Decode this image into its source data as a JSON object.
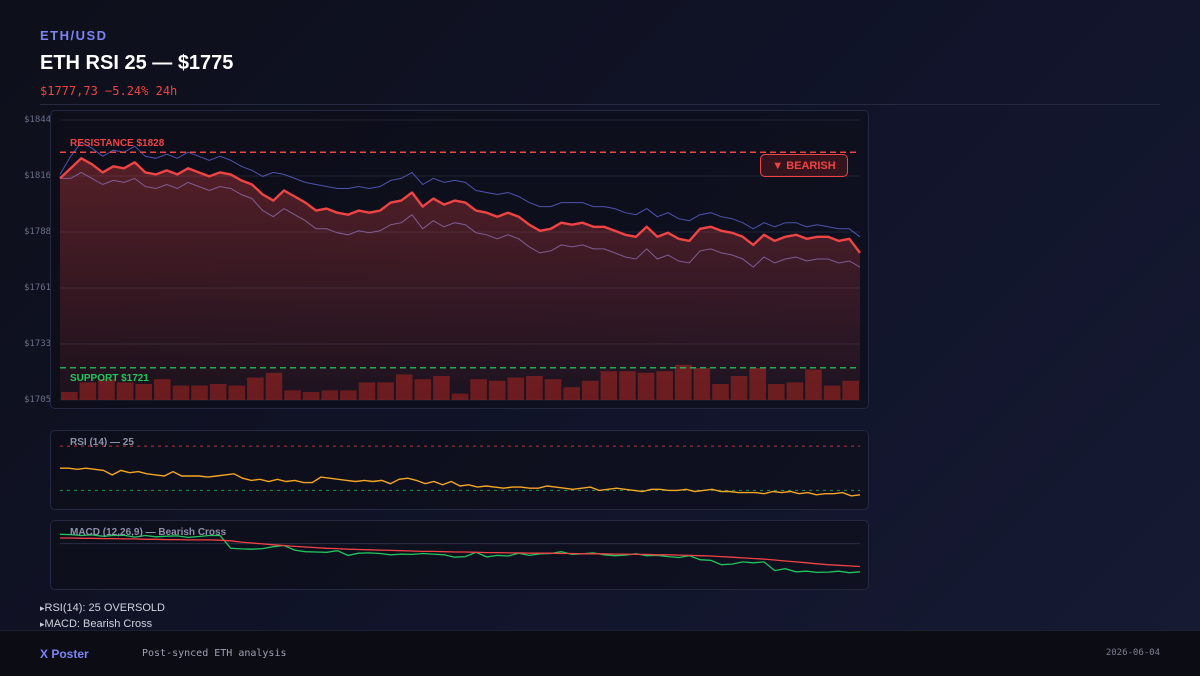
{
  "header": {
    "pair": "ETH/USD",
    "title": "ETH RSI 25 — $1775",
    "price_line": "$1777,73 −5.24% 24h"
  },
  "chart_data": [
    {
      "type": "line",
      "ylim": [
        1705,
        1844
      ],
      "y_ticks": [
        "$1844",
        "$1816",
        "$1788",
        "$1761",
        "$1733",
        "$1705"
      ],
      "x": [
        1,
        2,
        3,
        4,
        5,
        6,
        7,
        8,
        9,
        10,
        11,
        12,
        13,
        14,
        15,
        16,
        17,
        18,
        19,
        20,
        21,
        22,
        23,
        24,
        25,
        26,
        27,
        28,
        29,
        30,
        31,
        32,
        33,
        34,
        35,
        36,
        37,
        38,
        39,
        40,
        41,
        42,
        43,
        44,
        45,
        46,
        47,
        48,
        49,
        50,
        51,
        52,
        53,
        54,
        55,
        56,
        57,
        58,
        59,
        60,
        61,
        62,
        63,
        64,
        65,
        66,
        67,
        68,
        69,
        70,
        71,
        72,
        73,
        74,
        75,
        76,
        77,
        78,
        79,
        80,
        81
      ],
      "series": [
        {
          "role": "price",
          "color": "#ef4444",
          "values": [
            1815,
            1820,
            1825,
            1822,
            1818,
            1821,
            1820,
            1823,
            1818,
            1817,
            1819,
            1817,
            1820,
            1818,
            1816,
            1818,
            1817,
            1814,
            1812,
            1807,
            1804,
            1809,
            1806,
            1803,
            1799,
            1800,
            1798,
            1797,
            1799,
            1798,
            1799,
            1803,
            1804,
            1808,
            1801,
            1805,
            1802,
            1804,
            1803,
            1799,
            1798,
            1796,
            1798,
            1796,
            1792,
            1789,
            1790,
            1793,
            1792,
            1793,
            1791,
            1791,
            1789,
            1787,
            1786,
            1791,
            1786,
            1788,
            1785,
            1784,
            1790,
            1791,
            1789,
            1788,
            1786,
            1782,
            1787,
            1784,
            1786,
            1787,
            1785,
            1786,
            1786,
            1784,
            1785,
            1778
          ]
        },
        {
          "role": "upper-band",
          "color": "#5b5fc7",
          "values": [
            1817,
            1826,
            1833,
            1830,
            1826,
            1829,
            1828,
            1831,
            1826,
            1825,
            1827,
            1825,
            1828,
            1826,
            1824,
            1826,
            1824,
            1821,
            1819,
            1816,
            1818,
            1817,
            1815,
            1813,
            1812,
            1811,
            1810,
            1810,
            1811,
            1810,
            1811,
            1814,
            1815,
            1818,
            1812,
            1815,
            1813,
            1814,
            1813,
            1809,
            1808,
            1807,
            1808,
            1806,
            1803,
            1801,
            1801,
            1803,
            1803,
            1803,
            1801,
            1801,
            1800,
            1798,
            1797,
            1800,
            1796,
            1798,
            1795,
            1794,
            1797,
            1798,
            1796,
            1795,
            1793,
            1790,
            1793,
            1791,
            1793,
            1793,
            1791,
            1792,
            1791,
            1790,
            1790,
            1786
          ]
        },
        {
          "role": "lower-band",
          "color": "#8b6aa8",
          "values": [
            1815,
            1815,
            1818,
            1815,
            1812,
            1814,
            1813,
            1815,
            1811,
            1810,
            1812,
            1810,
            1813,
            1811,
            1809,
            1811,
            1810,
            1807,
            1805,
            1799,
            1796,
            1800,
            1797,
            1794,
            1790,
            1790,
            1788,
            1787,
            1789,
            1788,
            1789,
            1792,
            1793,
            1797,
            1790,
            1794,
            1791,
            1793,
            1792,
            1788,
            1787,
            1785,
            1787,
            1785,
            1781,
            1778,
            1779,
            1782,
            1781,
            1782,
            1780,
            1780,
            1778,
            1776,
            1775,
            1780,
            1775,
            1777,
            1774,
            1773,
            1779,
            1780,
            1778,
            1777,
            1775,
            1771,
            1776,
            1773,
            1775,
            1776,
            1774,
            1775,
            1775,
            1773,
            1774,
            1771
          ]
        }
      ],
      "bars": {
        "color": "#7f1d1d",
        "values": [
          5,
          11,
          13,
          11,
          10,
          13,
          9,
          9,
          10,
          9,
          14,
          17,
          6,
          5,
          6,
          6,
          11,
          11,
          16,
          13,
          15,
          4,
          13,
          12,
          14,
          15,
          13,
          8,
          12,
          18,
          18,
          17,
          18,
          22,
          20,
          10,
          15,
          20,
          10,
          11,
          19,
          9,
          12
        ]
      },
      "resistance": {
        "value": 1828,
        "label": "RESISTANCE $1828",
        "color": "#ef4444"
      },
      "support": {
        "value": 1721,
        "label": "SUPPORT $1721",
        "color": "#22c55e"
      },
      "badge": "▼ BEARISH"
    },
    {
      "type": "line",
      "title": "RSI (14) — 25",
      "ylim": [
        15,
        80
      ],
      "levels": [
        {
          "value": 70,
          "color": "#ef4444"
        },
        {
          "value": 30,
          "color": "#22c55e"
        }
      ],
      "series": [
        {
          "role": "rsi",
          "color": "#f5a524",
          "values": [
            50,
            50,
            49,
            50,
            49,
            48,
            44,
            48,
            46,
            47,
            45,
            44,
            43,
            47,
            43,
            43,
            43,
            42,
            43,
            44,
            45,
            41,
            39,
            40,
            38,
            40,
            38,
            39,
            37,
            37,
            42,
            41,
            40,
            39,
            38,
            39,
            38,
            39,
            36,
            40,
            41,
            39,
            36,
            38,
            35,
            38,
            34,
            35,
            33,
            34,
            33,
            32,
            33,
            33,
            32,
            32,
            34,
            33,
            32,
            31,
            32,
            33,
            30,
            31,
            32,
            31,
            30,
            29,
            31,
            31,
            30,
            30,
            31,
            29,
            30,
            31,
            29,
            29,
            28,
            28,
            28,
            27,
            29,
            28,
            29,
            27,
            28,
            26,
            27,
            27,
            28,
            25,
            26
          ]
        }
      ]
    },
    {
      "type": "line",
      "title": "MACD (12,26,9) — Bearish Cross",
      "ylim": [
        -14,
        6
      ],
      "zero": 0,
      "series": [
        {
          "role": "macd",
          "color": "#22c55e",
          "values": [
            3.0,
            2.9,
            2.6,
            2.8,
            2.4,
            2.6,
            2.7,
            2.1,
            2.6,
            2.2,
            2.4,
            2.5,
            2.0,
            2.3,
            2.6,
            2.6,
            -1.5,
            -1.7,
            -1.8,
            -1.6,
            -1.0,
            -0.6,
            -2.1,
            -2.6,
            -2.7,
            -2.8,
            -2.3,
            -3.8,
            -3.1,
            -3.0,
            -3.2,
            -3.6,
            -3.4,
            -3.5,
            -3.2,
            -3.4,
            -3.6,
            -4.4,
            -4.2,
            -2.8,
            -4.3,
            -3.8,
            -4.0,
            -3.1,
            -3.8,
            -3.3,
            -3.2,
            -2.6,
            -3.5,
            -3.3,
            -3.0,
            -3.6,
            -3.9,
            -3.7,
            -3.3,
            -3.9,
            -3.8,
            -4.2,
            -4.5,
            -3.9,
            -5.2,
            -5.4,
            -6.8,
            -6.6,
            -5.9,
            -6.2,
            -5.9,
            -8.7,
            -8.1,
            -9.1,
            -8.9,
            -9.3,
            -9.2,
            -8.9,
            -9.4,
            -9.1
          ]
        },
        {
          "role": "signal",
          "color": "#ef4444",
          "values": [
            1.8,
            1.8,
            1.7,
            1.7,
            1.6,
            1.6,
            1.5,
            1.5,
            1.4,
            1.4,
            1.3,
            1.3,
            1.2,
            1.2,
            1.2,
            1.1,
            0.9,
            0.5,
            0.2,
            -0.1,
            -0.4,
            -0.6,
            -0.9,
            -1.1,
            -1.3,
            -1.5,
            -1.6,
            -1.8,
            -1.9,
            -2.0,
            -2.1,
            -2.2,
            -2.3,
            -2.4,
            -2.5,
            -2.5,
            -2.6,
            -2.7,
            -2.7,
            -2.8,
            -2.9,
            -2.9,
            -3.0,
            -3.0,
            -3.1,
            -3.1,
            -3.1,
            -3.2,
            -3.2,
            -3.3,
            -3.3,
            -3.3,
            -3.4,
            -3.4,
            -3.5,
            -3.5,
            -3.6,
            -3.6,
            -3.7,
            -3.8,
            -3.9,
            -4.0,
            -4.2,
            -4.4,
            -4.6,
            -4.8,
            -5.0,
            -5.3,
            -5.6,
            -5.9,
            -6.2,
            -6.5,
            -6.8,
            -7.0,
            -7.2,
            -7.4
          ]
        }
      ]
    }
  ],
  "notes": [
    "RSI(14): 25 OVERSOLD",
    "MACD: Bearish Cross"
  ],
  "footer": {
    "brand": "X Poster",
    "caption": "Post-synced ETH analysis",
    "date": "2026-06-04"
  }
}
